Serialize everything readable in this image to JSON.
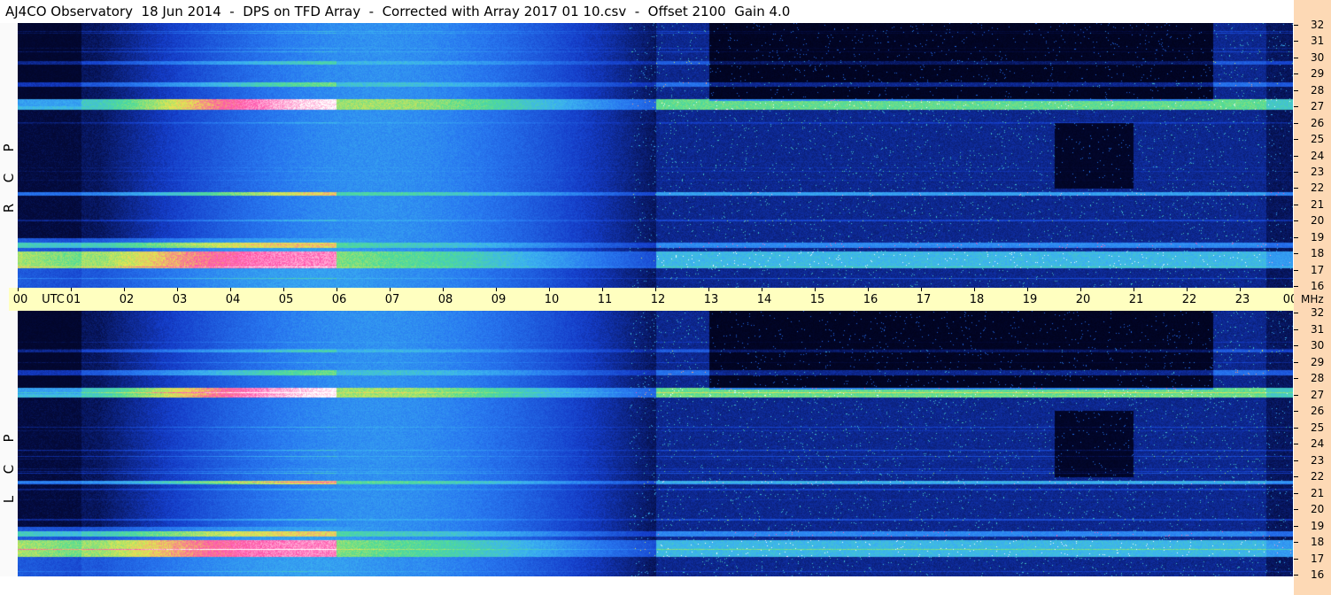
{
  "title": "AJ4CO Observatory  18 Jun 2014  -  DPS on TFD Array  -  Corrected with Array 2017 01 10.csv  -  Offset 2100  Gain 4.0",
  "panels": [
    {
      "polarization_letters": [
        "R",
        "C",
        "P"
      ]
    },
    {
      "polarization_letters": [
        "L",
        "C",
        "P"
      ]
    }
  ],
  "time_axis": {
    "utc_label": "UTC",
    "end_label": "00",
    "unit_label": "MHz",
    "ticks": [
      "00",
      "01",
      "02",
      "03",
      "04",
      "05",
      "06",
      "07",
      "08",
      "09",
      "10",
      "11",
      "12",
      "13",
      "14",
      "15",
      "16",
      "17",
      "18",
      "19",
      "20",
      "21",
      "22",
      "23"
    ]
  },
  "chart_data": {
    "type": "heatmap",
    "title": "AJ4CO Observatory  18 Jun 2014  -  DPS on TFD Array  -  Corrected with Array 2017 01 10.csv  -  Offset 2100  Gain 4.0",
    "x_range_utc_hours": [
      0,
      24
    ],
    "y_range_mhz": [
      16,
      32
    ],
    "y_ticks": [
      32,
      31,
      30,
      29,
      28,
      27,
      26,
      25,
      24,
      23,
      22,
      21,
      20,
      19,
      18,
      17,
      16
    ],
    "panels": [
      "RCP",
      "LCP"
    ],
    "colors": {
      "background_low": "#000014",
      "mid": "#1b5fd8",
      "high": "#4fe08c",
      "peak": "#ff3ea0",
      "saturated": "#ffffff"
    }
  }
}
